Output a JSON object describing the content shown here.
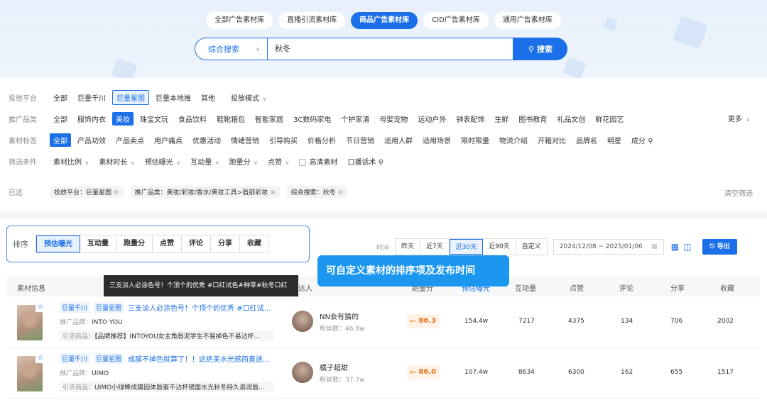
{
  "top_tabs": [
    "全部广告素材库",
    "直播引流素材库",
    "商品广告素材库",
    "CID广告素材库",
    "通用广告素材库"
  ],
  "search": {
    "mode": "综合搜索",
    "value": "秋冬",
    "button": "搜索"
  },
  "filters": {
    "platform": {
      "label": "投放平台",
      "options": [
        "全部",
        "巨量千川",
        "巨量星图",
        "巨量本地推",
        "其他"
      ],
      "extra": "投放模式"
    },
    "category": {
      "label": "推广品类",
      "options": [
        "全部",
        "服饰内衣",
        "美妆",
        "珠宝文玩",
        "食品饮料",
        "鞋靴箱包",
        "智能家居",
        "3C数码家电",
        "个护家清",
        "母婴宠物",
        "运动户外",
        "钟表配饰",
        "生鲜",
        "图书教育",
        "礼品文创",
        "鲜花园艺"
      ],
      "more": "更多"
    },
    "tags": {
      "label": "素材标签",
      "options": [
        "全部",
        "产品功效",
        "产品卖点",
        "用户痛点",
        "优惠活动",
        "情绪营销",
        "引导购买",
        "价格分析",
        "节日营销",
        "适用人群",
        "适用场景",
        "限时限量",
        "物流介绍",
        "开箱对比",
        "品牌名",
        "明星",
        "成分"
      ]
    },
    "conditions": {
      "label": "筛选条件",
      "options": [
        "素材比例",
        "素材时长",
        "预估曝光",
        "互动量",
        "跑量分",
        "点赞"
      ],
      "hd": "高清素材",
      "speech": "口播话术"
    },
    "selected": {
      "label": "已选",
      "chips": [
        "投放平台：巨量星图",
        "推广品类：美妆/彩妆/香水/美妆工具>唇部彩妆",
        "综合搜索：秋冬"
      ],
      "clear": "清空筛选"
    }
  },
  "sort": {
    "label": "排序",
    "options": [
      "预估曝光",
      "互动量",
      "跑量分",
      "点赞",
      "评论",
      "分享",
      "收藏"
    ]
  },
  "time": {
    "label": "时间",
    "options": [
      "昨天",
      "近7天",
      "近30天",
      "近90天",
      "自定义"
    ],
    "range": "2024/12/08 ~ 2025/01/06",
    "export": "导出"
  },
  "callout": "可自定义素材的排序项及发布时间",
  "tooltip": "三支淡人必涂色号！个顶个的优秀 #口红试色#种草#秋冬口红",
  "table": {
    "headers": {
      "info": "素材信息",
      "author": "达人",
      "score": "跑量分",
      "exposure": "预估曝光",
      "interact": "互动量",
      "likes": "点赞",
      "comments": "评论",
      "shares": "分享",
      "fav": "收藏"
    },
    "rows": [
      {
        "tags": [
          "巨量千川",
          "巨量星图"
        ],
        "title": "三支淡人必涂色号！个顶个的优秀 #口红试...",
        "brand_label": "推广品牌：",
        "brand": "INTO YOU",
        "goods_label": "引流商品：",
        "goods": "【品牌推荐】INTOYOU女主角唇泥学生不易掉色不易沾杯...",
        "author": "NN会有猫的",
        "fans_label": "粉丝数：",
        "fans": "46.8w",
        "score": "86.3",
        "exposure": "154.4w",
        "interact": "7217",
        "likes": "4375",
        "comments": "134",
        "shares": "706",
        "fav": "2002"
      },
      {
        "tags": [
          "巨量千川",
          "巨量星图"
        ],
        "title": "成膜不掉色就算了！！这绝美水光感简直迷...",
        "brand_label": "推广品牌：",
        "brand": "UIMO",
        "goods_label": "引流商品：",
        "goods": "UIMO小绿棒成膜固体唇蜜不沾杯镜面水光秋冬持久滋润唇...",
        "author": "橘子超甜",
        "fans_label": "粉丝数：",
        "fans": "37.7w",
        "score": "86.0",
        "exposure": "107.4w",
        "interact": "8634",
        "likes": "6300",
        "comments": "162",
        "shares": "655",
        "fav": "1517"
      }
    ]
  }
}
